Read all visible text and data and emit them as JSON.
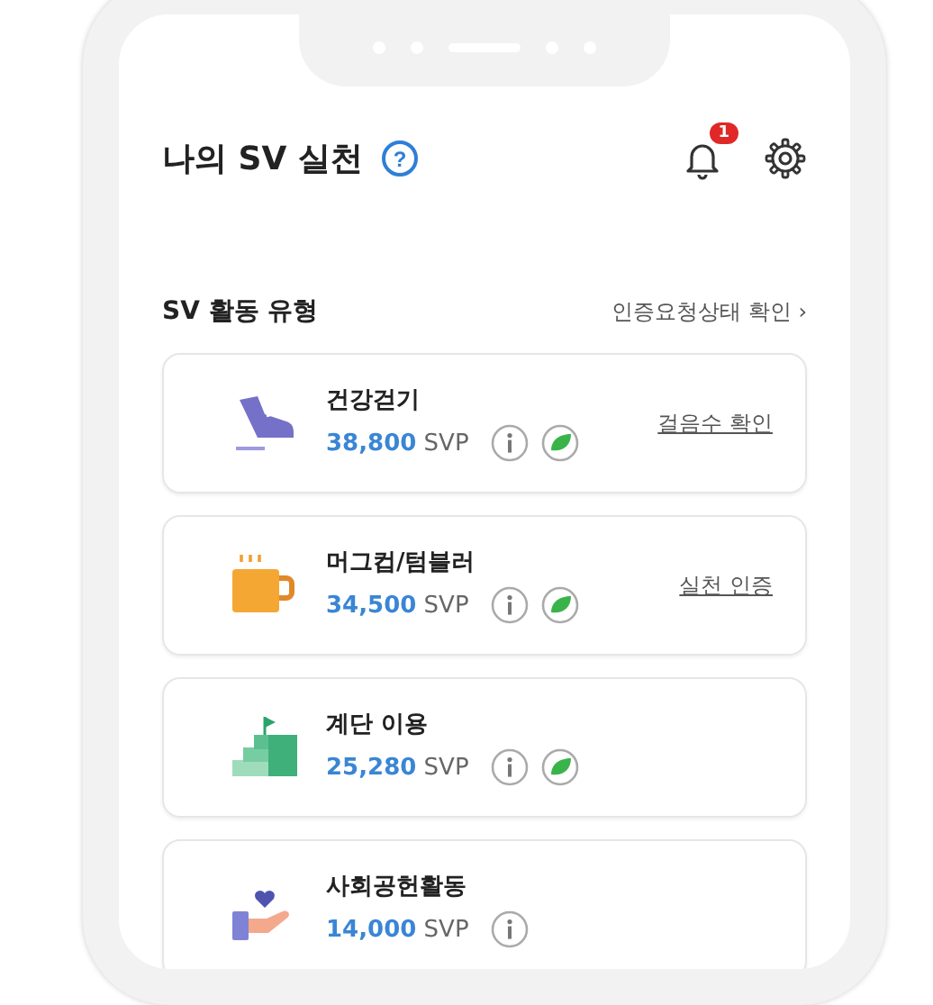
{
  "header": {
    "title": "나의 SV 실천",
    "help_glyph": "?",
    "notification_count": "1"
  },
  "section": {
    "title": "SV 활동 유형",
    "link": "인증요청상태 확인",
    "link_arrow": "›"
  },
  "activities": [
    {
      "kind": "shoe",
      "name": "건강걷기",
      "points": "38,800",
      "unit": "SVP",
      "eco": true,
      "action": "걸음수 확인"
    },
    {
      "kind": "mug",
      "name": "머그컵/텀블러",
      "points": "34,500",
      "unit": "SVP",
      "eco": true,
      "action": "실천 인증"
    },
    {
      "kind": "stairs",
      "name": "계단 이용",
      "points": "25,280",
      "unit": "SVP",
      "eco": true
    },
    {
      "kind": "hand",
      "name": "사회공헌활동",
      "points": "14,000",
      "unit": "SVP",
      "eco": false
    }
  ]
}
